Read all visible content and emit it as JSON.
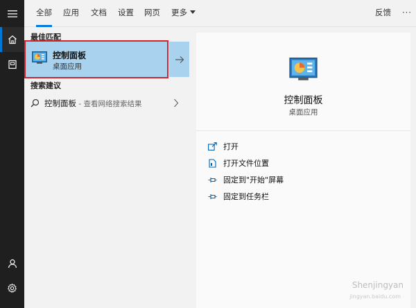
{
  "tabs": [
    {
      "label": "全部",
      "active": true
    },
    {
      "label": "应用"
    },
    {
      "label": "文档"
    },
    {
      "label": "设置"
    },
    {
      "label": "网页"
    },
    {
      "label": "更多"
    }
  ],
  "header_right": {
    "feedback": "反馈",
    "more_options": "···"
  },
  "best_match": {
    "section_title": "最佳匹配",
    "title": "控制面板",
    "subtitle": "桌面应用"
  },
  "search_suggestions": {
    "section_title": "搜索建议",
    "item_label": "控制面板",
    "item_sub": " - 查看网络搜索结果"
  },
  "preview": {
    "title": "控制面板",
    "subtitle": "桌面应用",
    "actions": [
      "打开",
      "打开文件位置",
      "固定到\"开始\"屏幕",
      "固定到任务栏"
    ]
  },
  "watermark": {
    "text": "Shenjingyan",
    "sub": "jingyan.baidu.com"
  },
  "colors": {
    "accent": "#0078d7",
    "selection": "#a9d2ef",
    "highlight_border": "#d6242f",
    "rail": "#1f1f1f"
  },
  "icons": [
    "hamburger-menu-icon",
    "home-icon",
    "documents-icon",
    "user-icon",
    "settings-icon",
    "control-panel-icon",
    "search-icon",
    "arrow-right-icon",
    "chevron-right-icon",
    "open-icon",
    "folder-location-icon",
    "pin-icon"
  ]
}
